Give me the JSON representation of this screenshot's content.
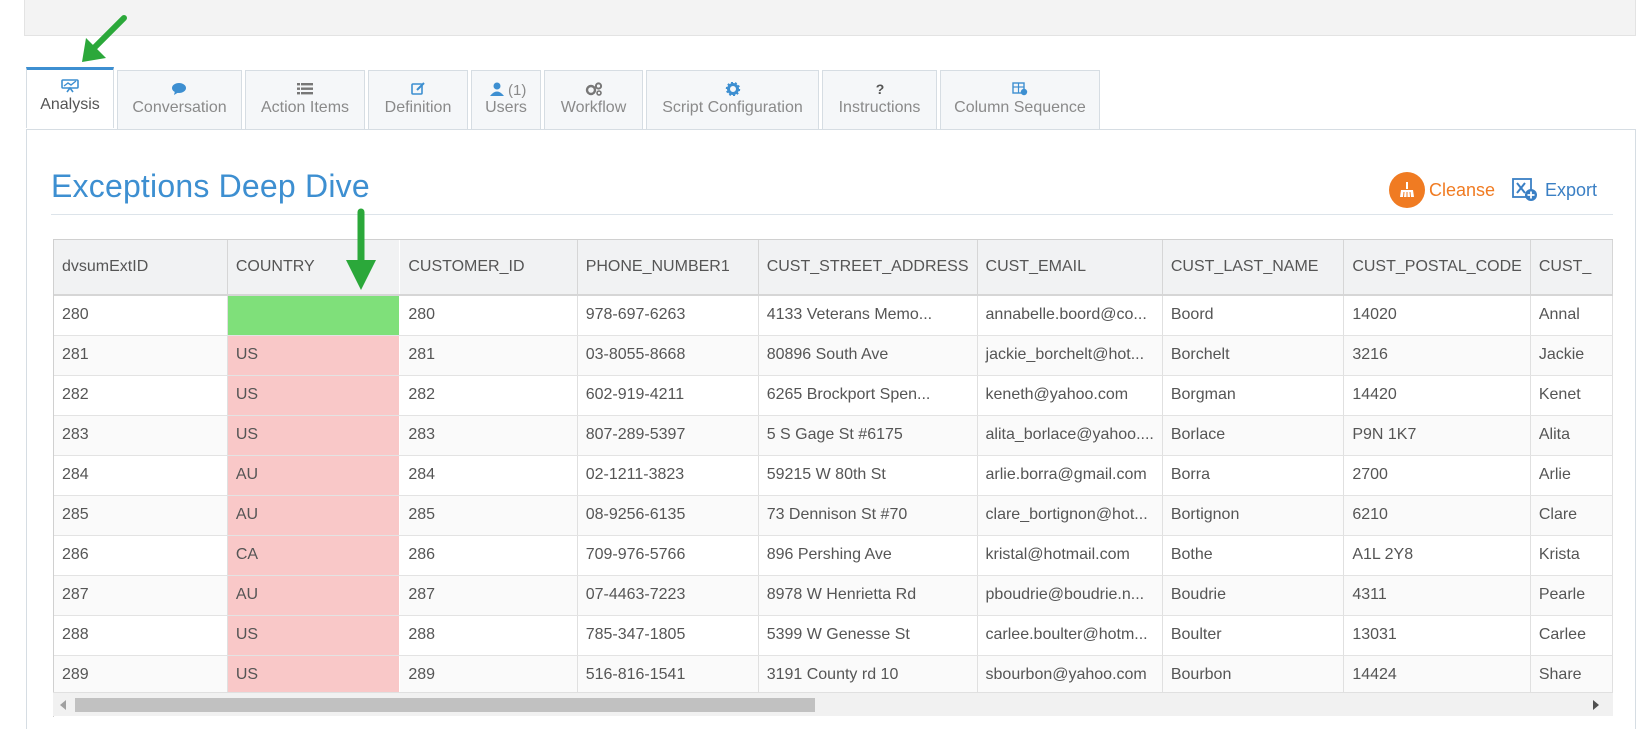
{
  "tabs": [
    {
      "label": "Analysis",
      "icon": "analysis-icon",
      "active": true
    },
    {
      "label": "Conversation",
      "icon": "comments-icon"
    },
    {
      "label": "Action Items",
      "icon": "list-icon"
    },
    {
      "label": "Definition",
      "icon": "edit-icon"
    },
    {
      "label": "Users",
      "icon": "user-icon",
      "count": "(1)"
    },
    {
      "label": "Workflow",
      "icon": "cogs-icon"
    },
    {
      "label": "Script Configuration",
      "icon": "gear-icon"
    },
    {
      "label": "Instructions",
      "icon": "question-icon"
    },
    {
      "label": "Column Sequence",
      "icon": "column-sequence-icon"
    }
  ],
  "title": "Exceptions Deep Dive",
  "actions": {
    "cleanse_label": "Cleanse",
    "export_label": "Export"
  },
  "colors": {
    "accent": "#3d8fd1",
    "cleanse": "#f07b22",
    "valid_cell": "#7fe07a",
    "invalid_cell": "#f9c8c8",
    "arrow": "#2ba83a"
  },
  "table": {
    "columns": [
      "dvsumExtID",
      "COUNTRY",
      "CUSTOMER_ID",
      "PHONE_NUMBER1",
      "CUST_STREET_ADDRESS",
      "CUST_EMAIL",
      "CUST_LAST_NAME",
      "CUST_POSTAL_CODE",
      "CUST_"
    ],
    "rows": [
      {
        "cells": [
          "280",
          "",
          "280",
          "978-697-6263",
          "4133 Veterans Memo...",
          "annabelle.boord@co...",
          "Boord",
          "14020",
          "Annal"
        ],
        "country_status": "valid"
      },
      {
        "cells": [
          "281",
          "US",
          "281",
          "03-8055-8668",
          "80896 South Ave",
          "jackie_borchelt@hot...",
          "Borchelt",
          "3216",
          "Jackie"
        ],
        "country_status": "invalid"
      },
      {
        "cells": [
          "282",
          "US",
          "282",
          "602-919-4211",
          "6265 Brockport Spen...",
          "keneth@yahoo.com",
          "Borgman",
          "14420",
          "Kenet"
        ],
        "country_status": "invalid"
      },
      {
        "cells": [
          "283",
          "US",
          "283",
          "807-289-5397",
          "5 S Gage St #6175",
          "alita_borlace@yahoo....",
          "Borlace",
          "P9N 1K7",
          "Alita"
        ],
        "country_status": "invalid"
      },
      {
        "cells": [
          "284",
          "AU",
          "284",
          "02-1211-3823",
          "59215 W 80th St",
          "arlie.borra@gmail.com",
          "Borra",
          "2700",
          "Arlie"
        ],
        "country_status": "invalid"
      },
      {
        "cells": [
          "285",
          "AU",
          "285",
          "08-9256-6135",
          "73 Dennison St #70",
          "clare_bortignon@hot...",
          "Bortignon",
          "6210",
          "Clare"
        ],
        "country_status": "invalid"
      },
      {
        "cells": [
          "286",
          "CA",
          "286",
          "709-976-5766",
          "896 Pershing Ave",
          "kristal@hotmail.com",
          "Bothe",
          "A1L 2Y8",
          "Krista"
        ],
        "country_status": "invalid"
      },
      {
        "cells": [
          "287",
          "AU",
          "287",
          "07-4463-7223",
          "8978 W Henrietta Rd",
          "pboudrie@boudrie.n...",
          "Boudrie",
          "4311",
          "Pearle"
        ],
        "country_status": "invalid"
      },
      {
        "cells": [
          "288",
          "US",
          "288",
          "785-347-1805",
          "5399 W Genesse St",
          "carlee.boulter@hotm...",
          "Boulter",
          "13031",
          "Carlee"
        ],
        "country_status": "invalid"
      },
      {
        "cells": [
          "289",
          "US",
          "289",
          "516-816-1541",
          "3191 County rd 10",
          "sbourbon@yahoo.com",
          "Bourbon",
          "14424",
          "Share"
        ],
        "country_status": "invalid"
      }
    ]
  }
}
